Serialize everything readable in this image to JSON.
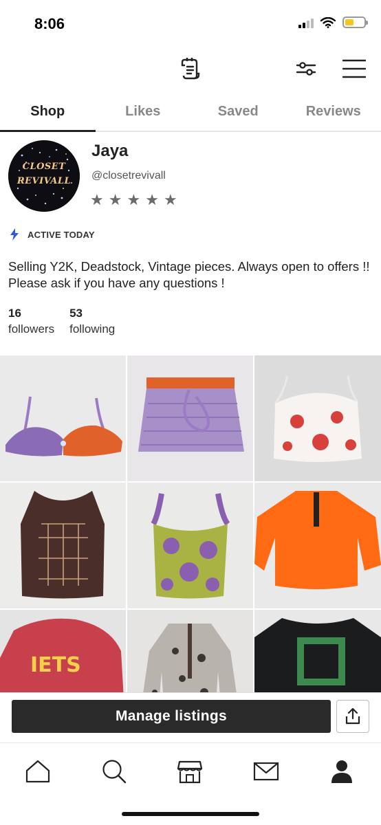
{
  "status_bar": {
    "time": "8:06",
    "battery_level": 0.45,
    "battery_color": "#f3c623"
  },
  "header": {
    "icons": [
      "receipt-icon",
      "filter-sliders-icon",
      "hamburger-menu-icon"
    ]
  },
  "tabs": [
    {
      "label": "Shop",
      "active": true
    },
    {
      "label": "Likes",
      "active": false
    },
    {
      "label": "Saved",
      "active": false
    },
    {
      "label": "Reviews",
      "active": false
    }
  ],
  "profile": {
    "avatar_text_line1": "CLOSET",
    "avatar_text_line2": "REVIVALL",
    "name": "Jaya",
    "handle": "@closetrevivall",
    "rating_stars": 5,
    "active_status": "ACTIVE TODAY",
    "bio": "Selling Y2K, Deadstock, Vintage pieces.  Always open to offers !! Please ask if you have any questions !",
    "followers_count": "16",
    "followers_label": "followers",
    "following_count": "53",
    "following_label": "following"
  },
  "listings": [
    {
      "name": "crochet-bikini-top"
    },
    {
      "name": "crochet-mini-skirt"
    },
    {
      "name": "floral-cami-top"
    },
    {
      "name": "brown-embroidered-tank"
    },
    {
      "name": "green-floral-corset-top"
    },
    {
      "name": "orange-fleece-pullover"
    },
    {
      "name": "red-varsity-sweatshirt"
    },
    {
      "name": "patterned-long-sleeve-top"
    },
    {
      "name": "black-graphic-tee"
    }
  ],
  "actions": {
    "manage_label": "Manage listings"
  },
  "bottom_nav": [
    "home-icon",
    "search-icon",
    "shop-icon",
    "mail-icon",
    "profile-icon"
  ],
  "colors": {
    "accent": "#2a2a2a",
    "active_bolt": "#2d5bd7"
  }
}
